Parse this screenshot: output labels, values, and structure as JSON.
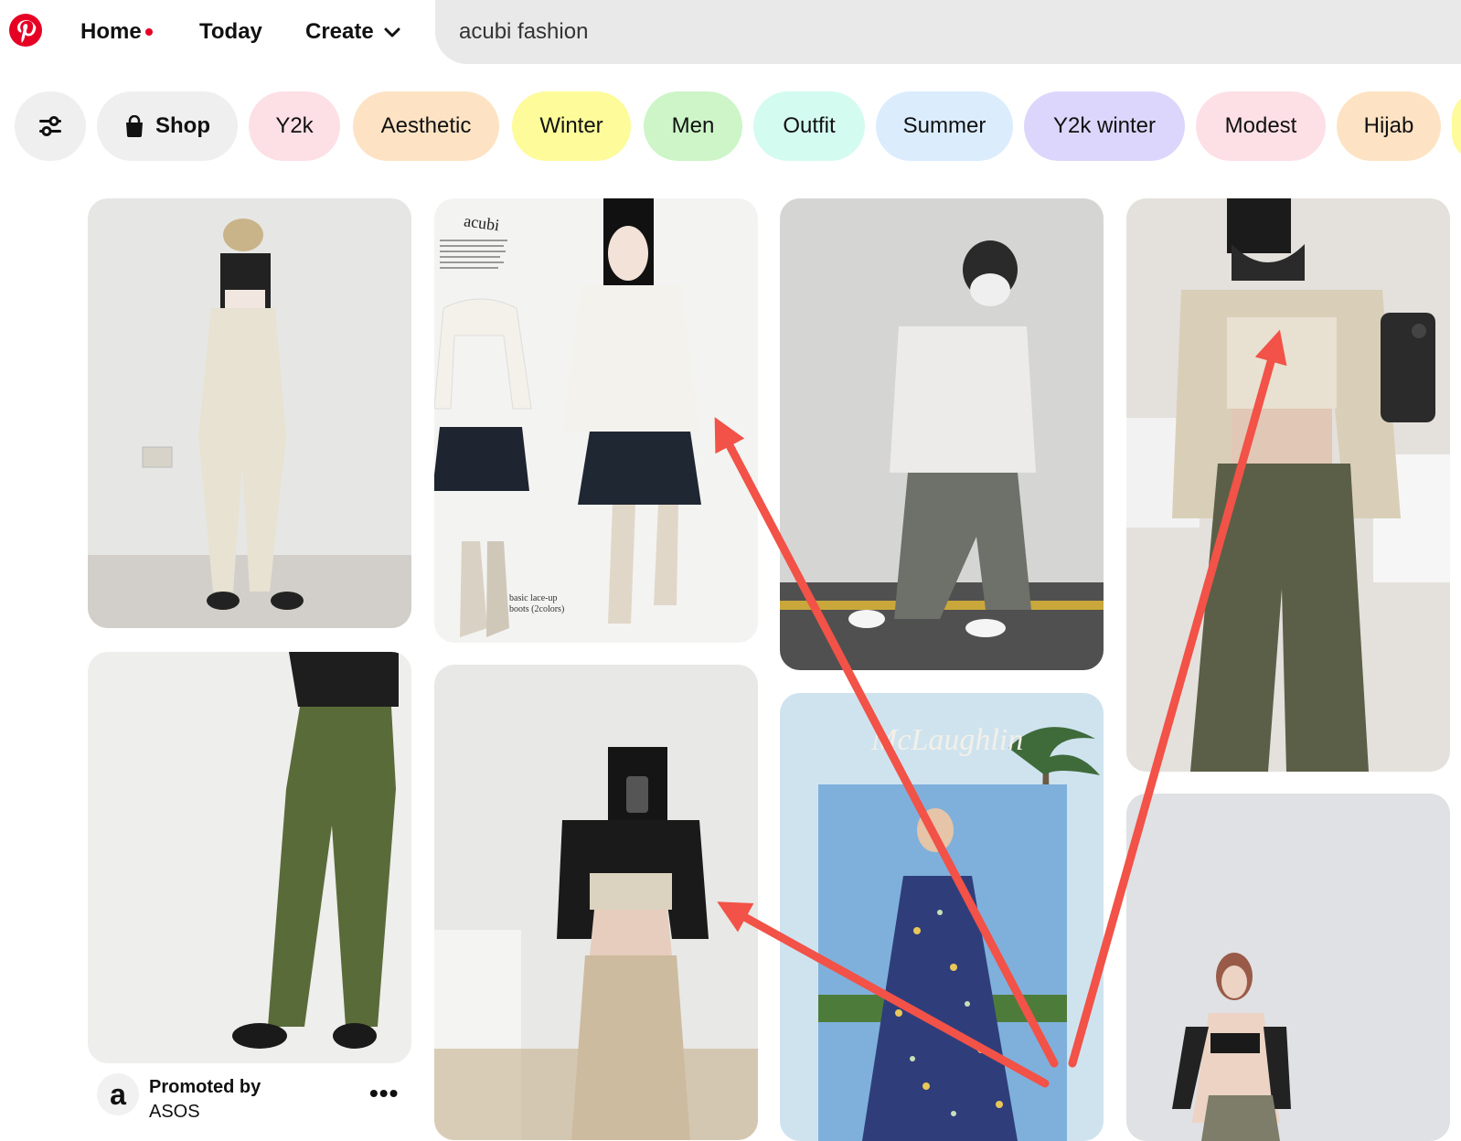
{
  "header": {
    "home_label": "Home",
    "today_label": "Today",
    "create_label": "Create",
    "search_value": "acubi fashion"
  },
  "chips": [
    {
      "label": "Y2k",
      "color": "#fde0e6"
    },
    {
      "label": "Aesthetic",
      "color": "#fde3c4"
    },
    {
      "label": "Winter",
      "color": "#fdfb9a"
    },
    {
      "label": "Men",
      "color": "#cdf5c8"
    },
    {
      "label": "Outfit",
      "color": "#d4fbf0"
    },
    {
      "label": "Summer",
      "color": "#dbecfd"
    },
    {
      "label": "Y2k winter",
      "color": "#ddd6fc"
    },
    {
      "label": "Modest",
      "color": "#fde0e6"
    },
    {
      "label": "Hijab",
      "color": "#fde3c4"
    }
  ],
  "shop_label": "Shop",
  "pins": {
    "text_acubi": "acubi",
    "text_boots": "basic lace-up",
    "text_boots2": "boots (2colors)",
    "text_brand": "McLaughlin"
  },
  "promo": {
    "label": "Promoted by",
    "brand": "ASOS",
    "avatar_letter": "a",
    "more_label": "•••"
  },
  "colors": {
    "brand_red": "#e60023",
    "arrow_red": "#f25247"
  }
}
